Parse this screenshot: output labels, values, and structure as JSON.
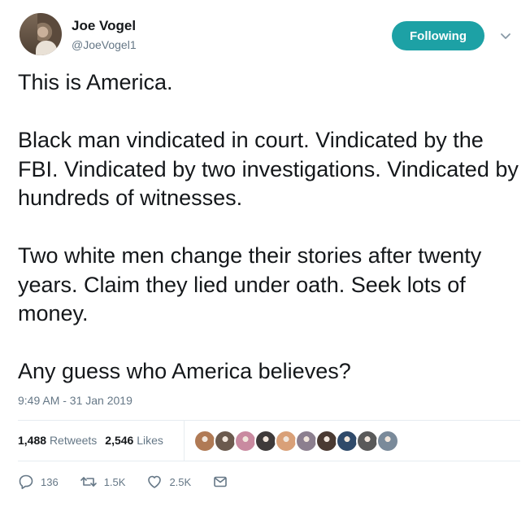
{
  "user": {
    "name": "Joe Vogel",
    "handle": "@JoeVogel1"
  },
  "follow_button": {
    "label": "Following",
    "color": "#1da1a5"
  },
  "tweet": {
    "paragraphs": [
      "This is America.",
      "Black man vindicated in court. Vindicated by the FBI. Vindicated by two investigations. Vindicated by hundreds of witnesses.",
      "Two white men change their stories after twenty years. Claim they lied under oath. Seek lots of money.",
      "Any guess who America believes?"
    ],
    "timestamp": "9:49 AM - 31 Jan 2019"
  },
  "stats": {
    "retweets_count": "1,488",
    "retweets_label": "Retweets",
    "likes_count": "2,546",
    "likes_label": "Likes"
  },
  "likers": [
    "#b07a55",
    "#6b5a4e",
    "#c98aa0",
    "#3e3a3a",
    "#d9a078",
    "#8c7f8f",
    "#4a3a32",
    "#2f4a6a",
    "#5a5a5a",
    "#7a8a9a"
  ],
  "actions": {
    "reply_count": "136",
    "retweet_count": "1.5K",
    "like_count": "2.5K"
  },
  "icons": [
    "reply-icon",
    "retweet-icon",
    "heart-icon",
    "mail-icon",
    "chevron-down-icon"
  ]
}
